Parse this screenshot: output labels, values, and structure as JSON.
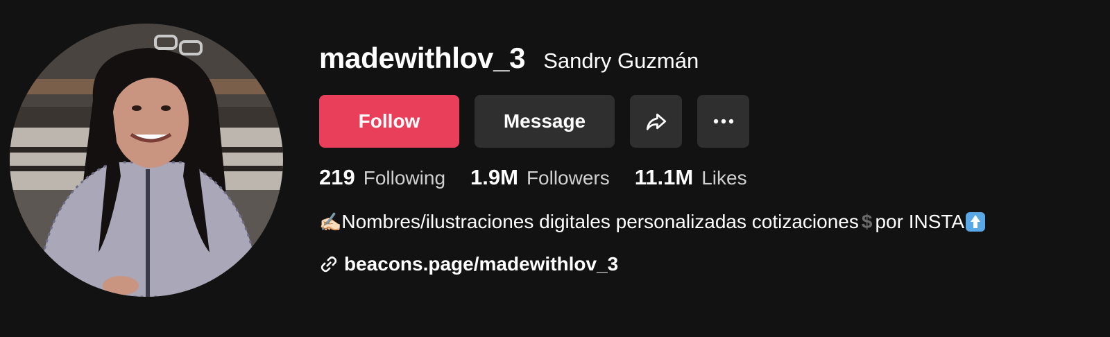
{
  "profile": {
    "username": "madewithlov_3",
    "nickname": "Sandry Guzmán"
  },
  "actions": {
    "follow_label": "Follow",
    "message_label": "Message",
    "share_icon": "share-arrow-icon",
    "more_icon": "more-dots-icon"
  },
  "stats": {
    "following": {
      "value": "219",
      "label": "Following"
    },
    "followers": {
      "value": "1.9M",
      "label": "Followers"
    },
    "likes": {
      "value": "11.1M",
      "label": "Likes"
    }
  },
  "bio": {
    "prefix_emoji": "✍🏻",
    "text": "Nombres/ilustraciones digitales personalizadas cotizaciones",
    "dollar": "$",
    "suffix": "por INSTA",
    "suffix_icon": "up-arrow-emoji"
  },
  "link": {
    "text": "beacons.page/madewithlov_3",
    "icon": "link-icon"
  },
  "colors": {
    "background": "#121212",
    "follow_button": "#ea3f5a",
    "secondary_button": "#2f2f2f",
    "muted_text": "#d0d0d0"
  }
}
